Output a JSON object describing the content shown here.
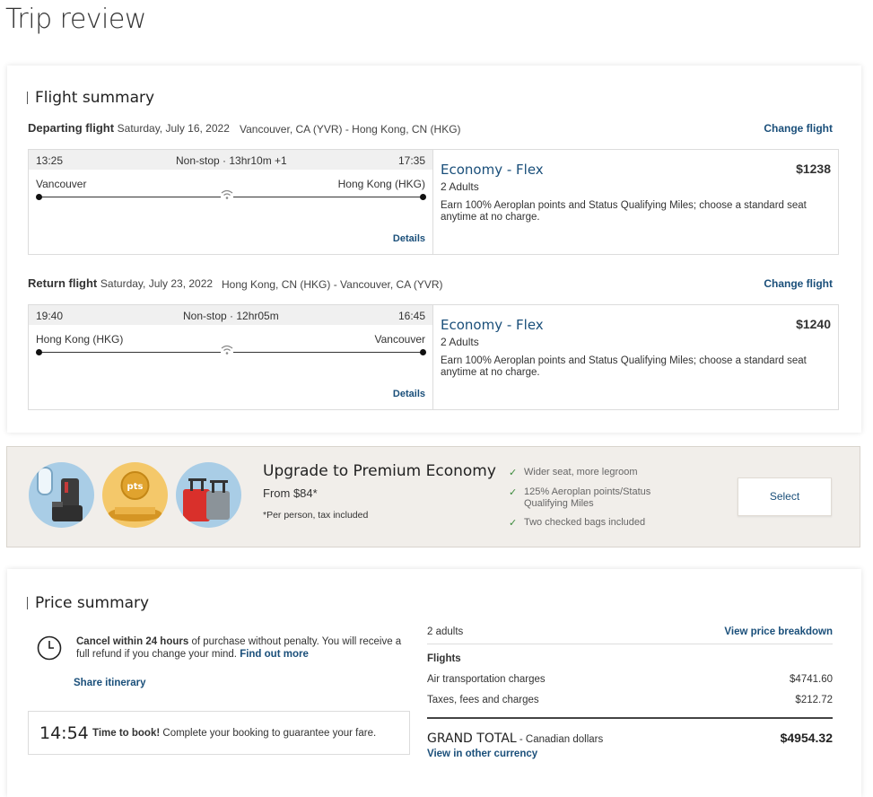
{
  "page": {
    "title": "Trip review"
  },
  "flight_summary": {
    "heading": "Flight summary",
    "change_label": "Change flight",
    "details_label": "Details",
    "flights": [
      {
        "label": "Departing flight",
        "date": "Saturday, July 16, 2022",
        "route": "Vancouver, CA (YVR) - Hong Kong, CN (HKG)",
        "depart_time": "13:25",
        "duration": "Non-stop · 13hr10m +1",
        "arrive_time": "17:35",
        "from_city": "Vancouver",
        "to_city": "Hong Kong (HKG)",
        "fare_name": "Economy - Flex",
        "fare_price": "$1238",
        "passengers": "2 Adults",
        "fare_desc": "Earn 100% Aeroplan points and Status Qualifying Miles; choose a standard seat anytime at no charge."
      },
      {
        "label": "Return flight",
        "date": "Saturday, July 23, 2022",
        "route": "Hong Kong, CN (HKG) - Vancouver, CA (YVR)",
        "depart_time": "19:40",
        "duration": "Non-stop · 12hr05m",
        "arrive_time": "16:45",
        "from_city": "Hong Kong (HKG)",
        "to_city": "Vancouver",
        "fare_name": "Economy - Flex",
        "fare_price": "$1240",
        "passengers": "2 Adults",
        "fare_desc": "Earn 100% Aeroplan points and Status Qualifying Miles; choose a standard seat anytime at no charge."
      }
    ]
  },
  "upgrade": {
    "title": "Upgrade to Premium Economy",
    "from_price": "From $84*",
    "note": "*Per person, tax included",
    "points_badge": "pts",
    "benefits": [
      "Wider seat, more legroom",
      "125% Aeroplan points/Status Qualifying Miles",
      "Two checked bags included"
    ],
    "select_label": "Select"
  },
  "price_summary": {
    "heading": "Price summary",
    "cancel_bold": "Cancel within 24 hours",
    "cancel_text": " of purchase without penalty. You will receive a full refund if you change your mind. ",
    "find_out_more": "Find out more",
    "share_itinerary": "Share itinerary",
    "timer": "14:54",
    "timer_bold": "Time to book!",
    "timer_text": " Complete your booking to guarantee your fare.",
    "adults": "2 adults",
    "view_breakdown": "View price breakdown",
    "flights_label": "Flights",
    "air_label": "Air transportation charges",
    "air_value": "$4741.60",
    "taxes_label": "Taxes, fees and charges",
    "taxes_value": "$212.72",
    "grand_label": "GRAND TOTAL",
    "grand_sub": " - Canadian dollars",
    "grand_value": "$4954.32",
    "other_currency": "View in other currency"
  }
}
